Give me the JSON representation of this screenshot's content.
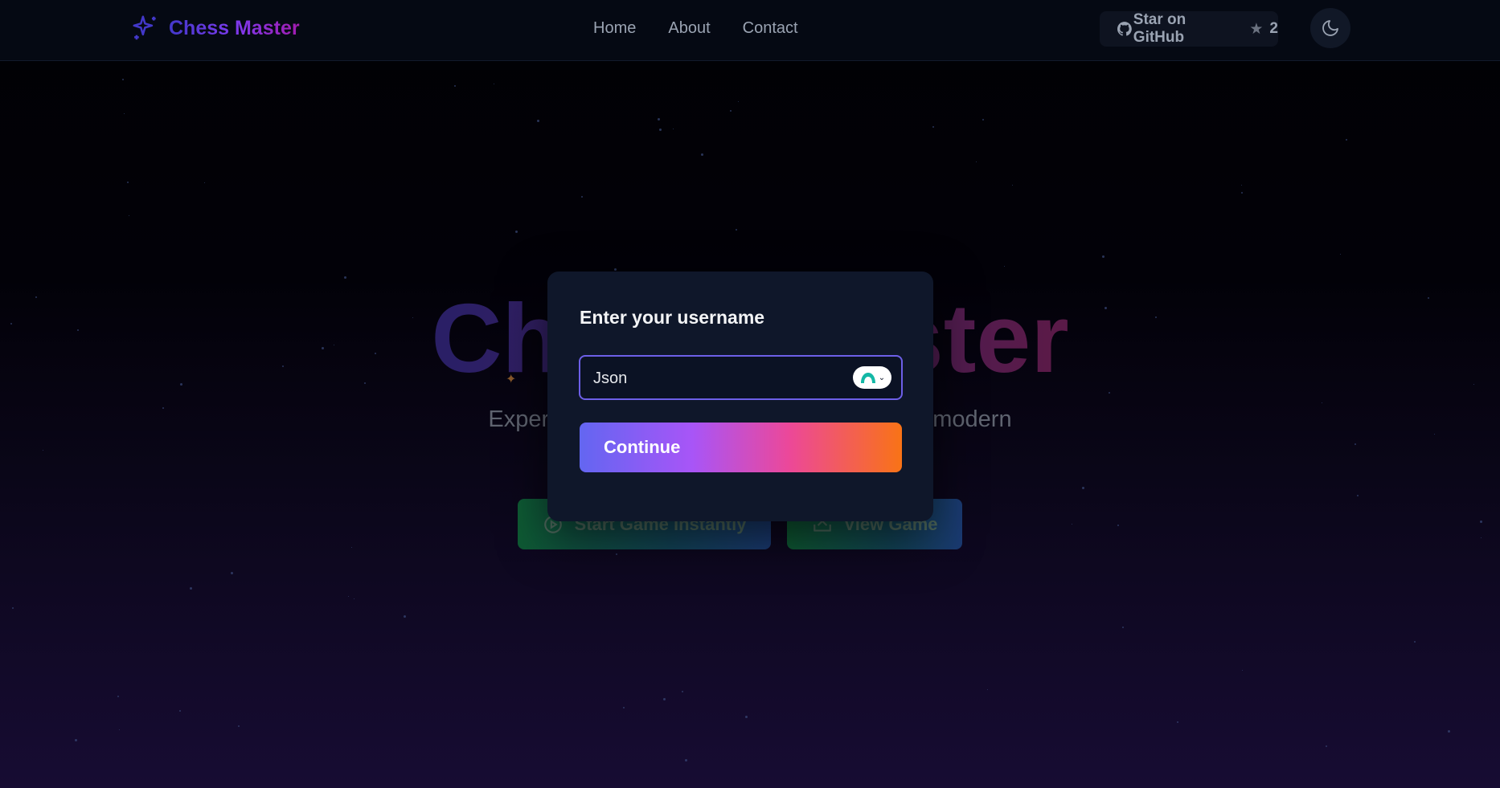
{
  "navbar": {
    "brand": "Chess Master",
    "links": [
      "Home",
      "About",
      "Contact"
    ],
    "github_label": "Star on GitHub",
    "github_stars": "2",
    "theme_icon": "moon-icon"
  },
  "hero": {
    "title": "Chess Master",
    "subtitle": "Experience the classic game of chess with modern",
    "start_button": "Start Game Instantly",
    "view_button": "View Game"
  },
  "modal": {
    "title": "Enter your username",
    "username_value": "Json",
    "continue_label": "Continue"
  },
  "colors": {
    "accent_border": "#6d5fe8",
    "button_gradient": [
      "#6366f1",
      "#a855f7",
      "#ec4899",
      "#f97316"
    ]
  }
}
